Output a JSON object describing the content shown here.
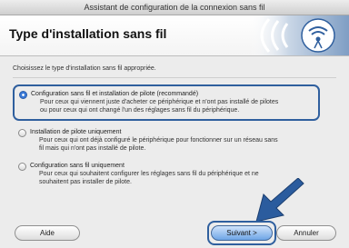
{
  "window": {
    "title": "Assistant de configuration de la connexion sans fil"
  },
  "banner": {
    "title": "Type d'installation sans fil"
  },
  "instruction": "Choisissez le type d'installation sans fil appropriée.",
  "options": [
    {
      "label": "Configuration sans fil et installation de pilote (recommandé)",
      "desc1": "Pour ceux qui viennent juste d'acheter ce périphérique et n'ont pas installé de pilotes",
      "desc2": "ou pour ceux qui ont changé l'un des réglages sans fil du périphérique.",
      "selected": true
    },
    {
      "label": "Installation de pilote uniquement",
      "desc1": "Pour ceux qui ont déjà configuré le périphérique pour fonctionner sur un réseau sans",
      "desc2": "fil mais qui n'ont pas installé de pilote.",
      "selected": false
    },
    {
      "label": "Configuration sans fil uniquement",
      "desc1": "Pour ceux qui souhaitent configurer les réglages sans fil du périphérique et ne",
      "desc2": "souhaitent pas installer de pilote.",
      "selected": false
    }
  ],
  "buttons": {
    "help": "Aide",
    "next": "Suivant >",
    "cancel": "Annuler"
  },
  "colors": {
    "accent": "#2f5f9e",
    "arrow": "#2b5c9e",
    "primary_button": "#6ea5e6"
  },
  "icons": {
    "wifi": "wifi-logo-icon",
    "pointer": "pointer-arrow-icon"
  }
}
